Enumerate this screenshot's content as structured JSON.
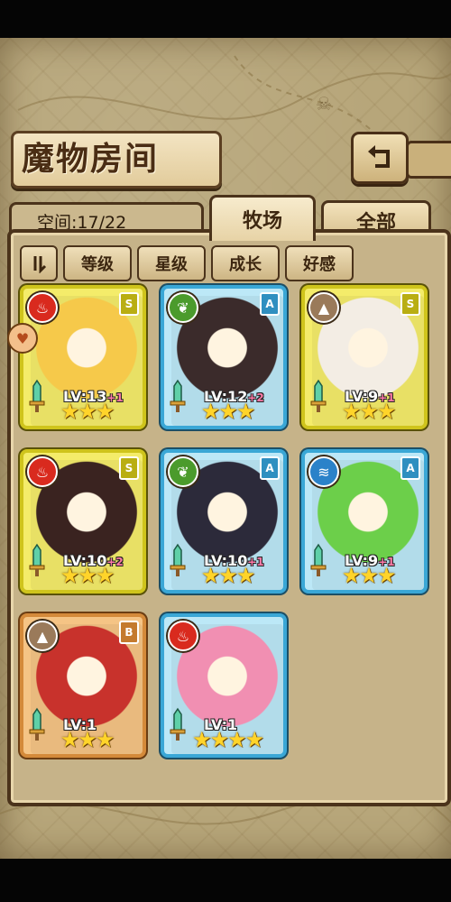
{
  "header": {
    "title": "魔物房间",
    "back_icon": "return-arrow-icon"
  },
  "tabs": {
    "space_label": "空间:17/22",
    "farm": "牧场",
    "all": "全部"
  },
  "sort_buttons": [
    "等级",
    "星级",
    "成长",
    "好感"
  ],
  "sort_toggle_icon": "sort-order-icon",
  "colors": {
    "fire": "#d92a1e",
    "nature": "#4b9b2c",
    "water": "#2b82c9",
    "earth": "#9a7a5a",
    "frame_gold": "#cfc41c",
    "frame_blue": "#3aa7d6",
    "frame_bronze": "#d48a3a"
  },
  "monsters": [
    {
      "element": "fire",
      "rank": "S",
      "level": "LV:13",
      "bonus": "+1",
      "stars": "★★★",
      "frame": "gold",
      "art": "#f6c94a"
    },
    {
      "element": "nature",
      "rank": "A",
      "level": "LV:12",
      "bonus": "+2",
      "stars": "★★★",
      "frame": "blue",
      "art": "#3b2b2b"
    },
    {
      "element": "earth",
      "rank": "S",
      "level": "LV:9",
      "bonus": "+1",
      "stars": "★★★",
      "frame": "gold",
      "art": "#f3ede4"
    },
    {
      "element": "fire",
      "rank": "S",
      "level": "LV:10",
      "bonus": "+2",
      "stars": "★★★",
      "frame": "gold",
      "art": "#3a2320"
    },
    {
      "element": "nature",
      "rank": "A",
      "level": "LV:10",
      "bonus": "+1",
      "stars": "★★★",
      "frame": "blue",
      "art": "#2c2a3a"
    },
    {
      "element": "water",
      "rank": "A",
      "level": "LV:9",
      "bonus": "+1",
      "stars": "★★★",
      "frame": "blue",
      "art": "#6ccf4a"
    },
    {
      "element": "earth",
      "rank": "B",
      "level": "LV:1",
      "bonus": "",
      "stars": "★★★",
      "frame": "bronze",
      "art": "#c8322c"
    },
    {
      "element": "fire",
      "rank": "",
      "level": "LV:1",
      "bonus": "",
      "stars": "★★★★",
      "frame": "blue",
      "art": "#f18fb2"
    }
  ]
}
